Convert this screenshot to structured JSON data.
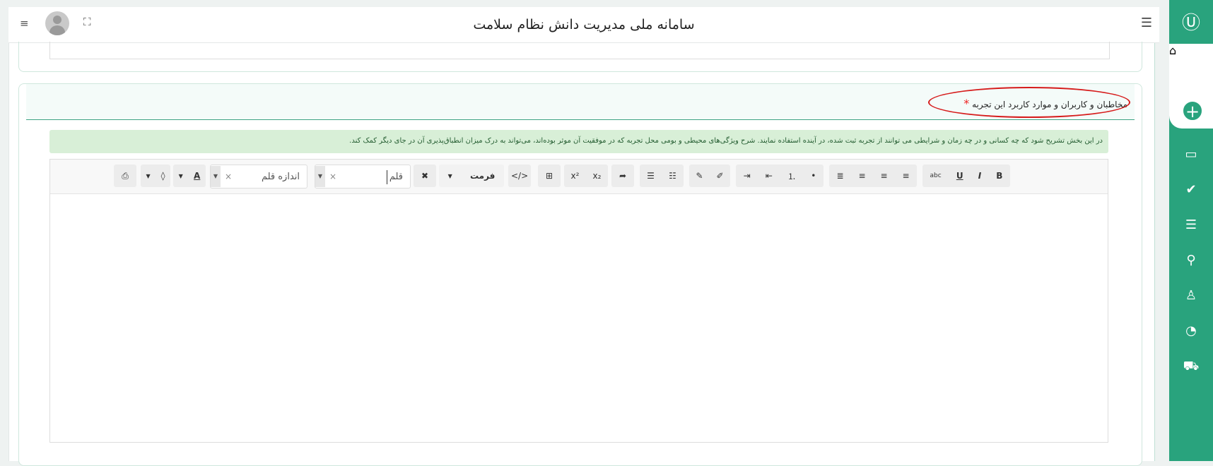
{
  "header": {
    "title": "سامانه ملی مدیریت دانش نظام سلامت",
    "menu_icon": "hamburger-icon",
    "expand_icon": "fullscreen-icon"
  },
  "sidebar": {
    "logo": "Ⓤ",
    "items": [
      {
        "name": "home",
        "icon": "⌂"
      },
      {
        "name": "add",
        "icon": "+"
      },
      {
        "name": "archive",
        "icon": "▭"
      },
      {
        "name": "check",
        "icon": "✔"
      },
      {
        "name": "list",
        "icon": "☰"
      },
      {
        "name": "search",
        "icon": "⚲"
      },
      {
        "name": "user",
        "icon": "♙"
      },
      {
        "name": "chart",
        "icon": "◔"
      },
      {
        "name": "cart",
        "icon": "⛟"
      }
    ]
  },
  "section": {
    "label": "مخاطبان و کاربران و موارد کاربرد این تجربه",
    "required_mark": "*",
    "hint": "در این بخش تشریح شود که چه کسانی و در چه زمان و شرایطی می توانند از تجربه ثبت شده، در آینده استفاده نمایند. شرح ویژگی‌های محیطی و بومی محل تجربه که در موفقیت آن موثر بوده‌اند، می‌تواند به درک میزان انطباق‌پذیری آن در جای دیگر کمک کند."
  },
  "toolbar": {
    "bold": "B",
    "italic": "I",
    "underline": "U",
    "strike": "abc",
    "format_label": "فرمت",
    "font_placeholder": "قلم",
    "size_placeholder": "اندازه قلم",
    "font_color": "A",
    "superscript": "x²",
    "subscript": "x₂",
    "code": "</>",
    "clear": "×"
  },
  "colors": {
    "accent": "#29a37d",
    "hint_bg": "#d8efd7",
    "required": "#e22222",
    "annotation": "#d61b1b"
  }
}
